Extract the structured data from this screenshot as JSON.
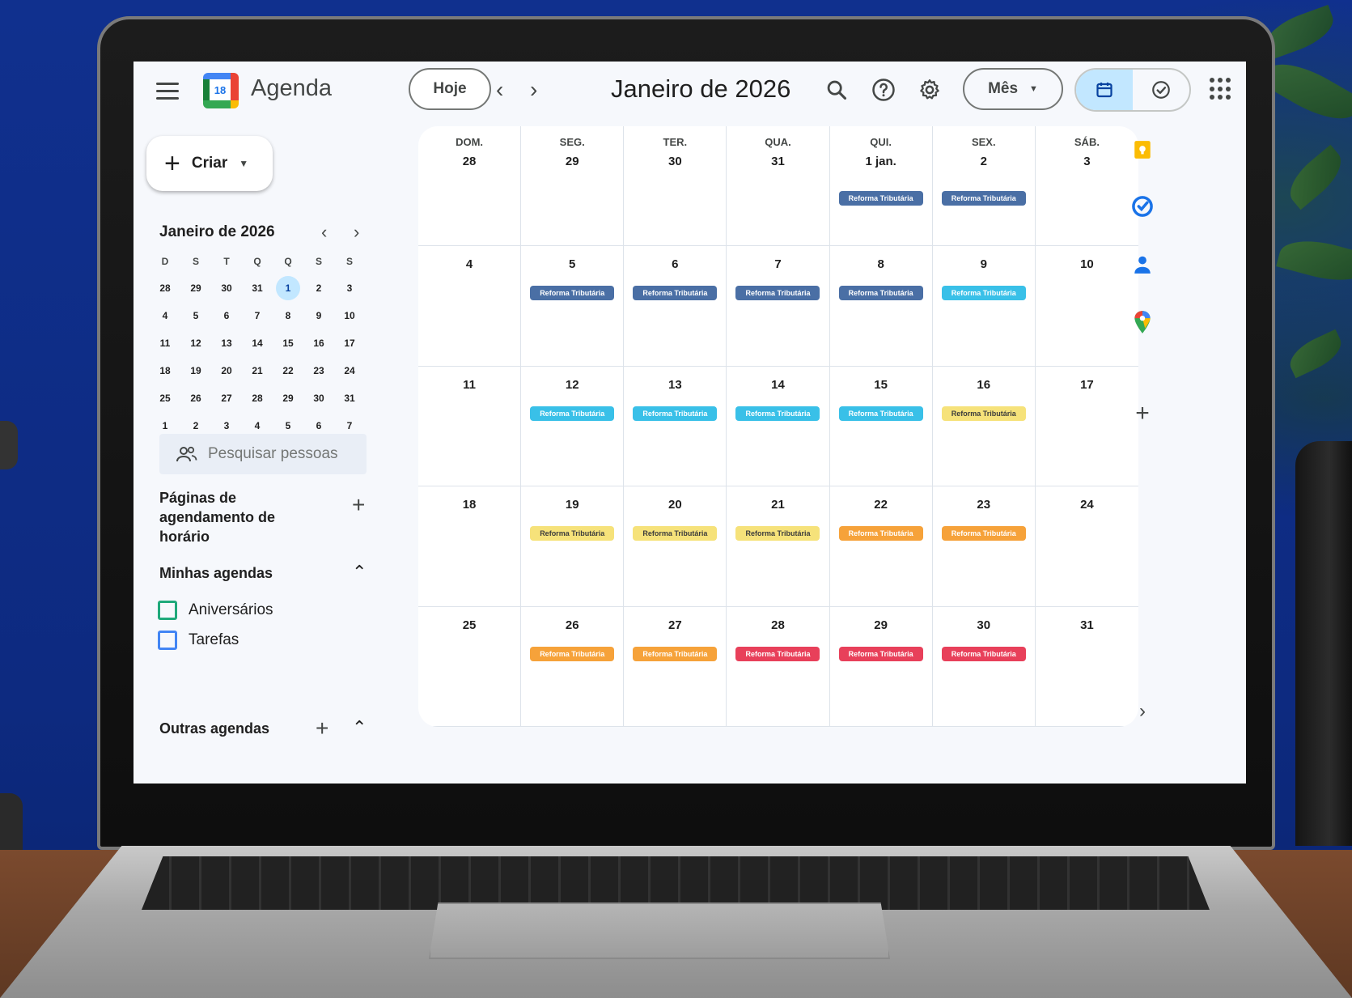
{
  "topbar": {
    "app_title": "Agenda",
    "logo_day": "18",
    "today_label": "Hoje",
    "prev_symbol": "‹",
    "next_symbol": "›",
    "month_title": "Janeiro de 2026",
    "view_label": "Mês"
  },
  "sidebar": {
    "create_label": "Criar",
    "mini_title": "Janeiro de 2026",
    "mini_prev": "‹",
    "mini_next": "›",
    "weekday_initials": [
      "D",
      "S",
      "T",
      "Q",
      "Q",
      "S",
      "S"
    ],
    "mini_weeks": [
      [
        "28",
        "29",
        "30",
        "31",
        "1",
        "2",
        "3"
      ],
      [
        "4",
        "5",
        "6",
        "7",
        "8",
        "9",
        "10"
      ],
      [
        "11",
        "12",
        "13",
        "14",
        "15",
        "16",
        "17"
      ],
      [
        "18",
        "19",
        "20",
        "21",
        "22",
        "23",
        "24"
      ],
      [
        "25",
        "26",
        "27",
        "28",
        "29",
        "30",
        "31"
      ],
      [
        "1",
        "2",
        "3",
        "4",
        "5",
        "6",
        "7"
      ]
    ],
    "mini_today": "1",
    "people_placeholder": "Pesquisar pessoas",
    "booking_pages_title": "Páginas de agendamento de horário",
    "my_calendars_title": "Minhas agendas",
    "my_calendars": [
      {
        "label": "Aniversários",
        "color": "#1fa97a"
      },
      {
        "label": "Tarefas",
        "color": "#4285f4"
      }
    ],
    "other_calendars_title": "Outras agendas"
  },
  "month": {
    "weekday_headers": [
      "DOM.",
      "SEG.",
      "TER.",
      "QUA.",
      "QUI.",
      "SEX.",
      "SÁB."
    ],
    "event_title": "Reforma Tributária",
    "colors": {
      "slate": "#4a6fa5",
      "cyan": "#39c0e8",
      "yellow": "#f6e27a",
      "orange": "#f6a23a",
      "red": "#e8405a"
    },
    "weeks": [
      [
        {
          "day": "28",
          "event": ""
        },
        {
          "day": "29",
          "event": ""
        },
        {
          "day": "30",
          "event": ""
        },
        {
          "day": "31",
          "event": ""
        },
        {
          "day": "1 jan.",
          "event": "slate"
        },
        {
          "day": "2",
          "event": "slate"
        },
        {
          "day": "3",
          "event": ""
        }
      ],
      [
        {
          "day": "4",
          "event": ""
        },
        {
          "day": "5",
          "event": "slate"
        },
        {
          "day": "6",
          "event": "slate"
        },
        {
          "day": "7",
          "event": "slate"
        },
        {
          "day": "8",
          "event": "slate"
        },
        {
          "day": "9",
          "event": "cyan"
        },
        {
          "day": "10",
          "event": ""
        }
      ],
      [
        {
          "day": "11",
          "event": ""
        },
        {
          "day": "12",
          "event": "cyan"
        },
        {
          "day": "13",
          "event": "cyan"
        },
        {
          "day": "14",
          "event": "cyan"
        },
        {
          "day": "15",
          "event": "cyan"
        },
        {
          "day": "16",
          "event": "yellow"
        },
        {
          "day": "17",
          "event": ""
        }
      ],
      [
        {
          "day": "18",
          "event": ""
        },
        {
          "day": "19",
          "event": "yellow"
        },
        {
          "day": "20",
          "event": "yellow"
        },
        {
          "day": "21",
          "event": "yellow"
        },
        {
          "day": "22",
          "event": "orange"
        },
        {
          "day": "23",
          "event": "orange"
        },
        {
          "day": "24",
          "event": ""
        }
      ],
      [
        {
          "day": "25",
          "event": ""
        },
        {
          "day": "26",
          "event": "orange"
        },
        {
          "day": "27",
          "event": "orange"
        },
        {
          "day": "28",
          "event": "red"
        },
        {
          "day": "29",
          "event": "red"
        },
        {
          "day": "30",
          "event": "red"
        },
        {
          "day": "31",
          "event": ""
        }
      ]
    ]
  },
  "side_panel": {
    "icons": [
      "keep-icon",
      "tasks-icon",
      "contacts-icon",
      "maps-icon",
      "add-addon-icon"
    ],
    "expand_symbol": "›"
  }
}
